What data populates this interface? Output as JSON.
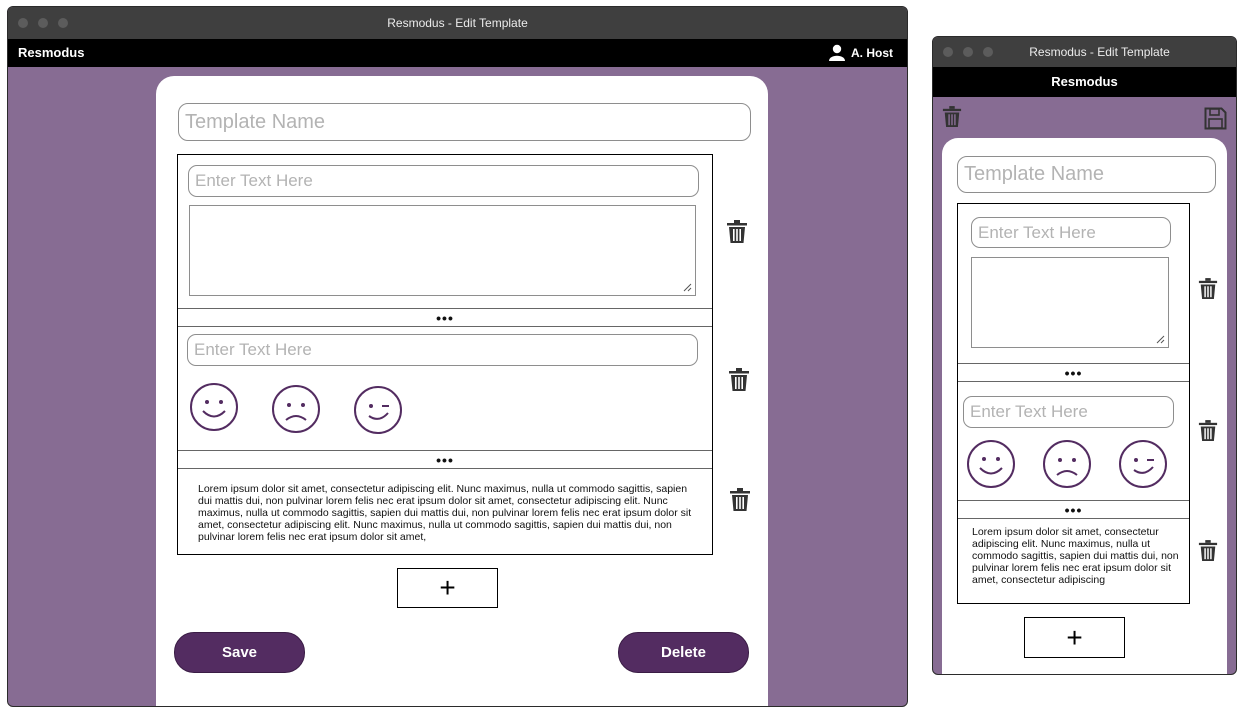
{
  "window_title": "Resmodus - Edit Template",
  "app_name": "Resmodus",
  "user_name": "A. Host",
  "template_name_placeholder": "Template Name",
  "text_placeholder": "Enter Text Here",
  "divider_label": "•••",
  "lorem_desktop": "Lorem ipsum dolor sit amet, consectetur adipiscing elit. Nunc maximus, nulla ut commodo sagittis, sapien dui mattis dui, non pulvinar lorem felis nec erat ipsum dolor sit amet, consectetur adipiscing elit. Nunc maximus, nulla ut commodo sagittis, sapien dui mattis dui, non pulvinar lorem felis nec erat ipsum dolor sit amet, consectetur adipiscing elit. Nunc maximus, nulla ut commodo sagittis, sapien dui mattis dui, non pulvinar lorem felis nec erat ipsum dolor sit amet,",
  "lorem_mobile": "Lorem ipsum dolor sit amet, consectetur adipiscing elit. Nunc maximus, nulla ut commodo sagittis, sapien dui mattis dui, non pulvinar lorem felis nec erat ipsum dolor sit amet, consectetur adipiscing",
  "add_label": "+",
  "save_label": "Save",
  "delete_label": "Delete",
  "faces": [
    "smile-face-icon",
    "frown-face-icon",
    "wink-face-icon"
  ],
  "icons": [
    "user-icon",
    "trash-icon",
    "save-disk-icon",
    "resize-grip-icon"
  ],
  "colors": {
    "background": "#876c93",
    "accent": "#532c61",
    "face_stroke": "#532c61",
    "titlebar": "#3f3f3f"
  }
}
